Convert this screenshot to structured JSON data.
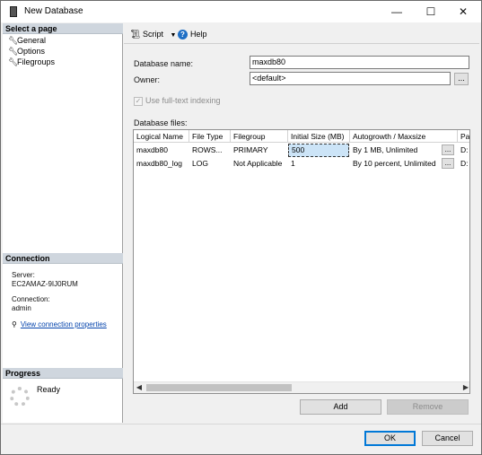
{
  "window": {
    "title": "New Database",
    "minimize": "—",
    "maximize": "☐",
    "close": "✕"
  },
  "left": {
    "select_page_header": "Select a page",
    "pages": [
      {
        "label": "General",
        "icon": "wrench-icon"
      },
      {
        "label": "Options",
        "icon": "wrench-icon"
      },
      {
        "label": "Filegroups",
        "icon": "wrench-icon"
      }
    ],
    "connection_header": "Connection",
    "server_label": "Server:",
    "server_value": "EC2AMAZ-9IJ0RUM",
    "connection_label": "Connection:",
    "connection_value": "admin",
    "view_props_link": "View connection properties",
    "progress_header": "Progress",
    "progress_status": "Ready"
  },
  "toolbar": {
    "script_label": "Script",
    "help_label": "Help"
  },
  "form": {
    "db_name_label": "Database name:",
    "db_name_value": "maxdb80",
    "owner_label": "Owner:",
    "owner_value": "<default>",
    "ellipsis": "...",
    "fulltext_label": "Use full-text indexing",
    "db_files_label": "Database files:"
  },
  "grid": {
    "columns": [
      "Logical Name",
      "File Type",
      "Filegroup",
      "Initial Size (MB)",
      "Autogrowth / Maxsize",
      "Pa"
    ],
    "rows": [
      {
        "logical": "maxdb80",
        "type": "ROWS...",
        "filegroup": "PRIMARY",
        "size": "500",
        "autogrowth": "By 1 MB, Unlimited",
        "path": "D:"
      },
      {
        "logical": "maxdb80_log",
        "type": "LOG",
        "filegroup": "Not Applicable",
        "size": "1",
        "autogrowth": "By 10 percent, Unlimited",
        "path": "D:"
      }
    ]
  },
  "buttons": {
    "add": "Add",
    "remove": "Remove",
    "ok": "OK",
    "cancel": "Cancel"
  }
}
